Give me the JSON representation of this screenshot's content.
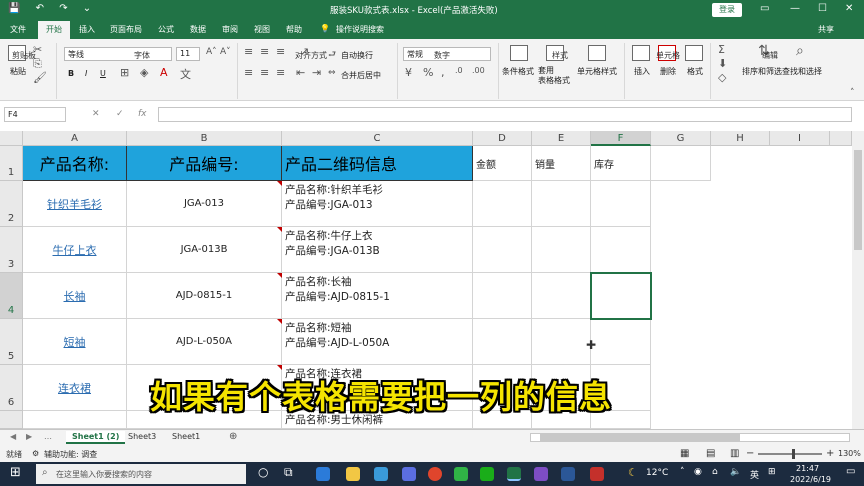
{
  "title_bar": {
    "title": "服装SKU款式表.xlsx  -  Excel(产品激活失败)",
    "login_label": "登录"
  },
  "ribbon_tabs": [
    "文件",
    "开始",
    "插入",
    "页面布局",
    "公式",
    "数据",
    "审阅",
    "视图",
    "帮助",
    "操作说明搜索"
  ],
  "share_label": "共享",
  "ribbon": {
    "paste_label": "粘贴",
    "clipboard_label": "剪贴板",
    "font_name": "等线",
    "font_size": "11",
    "font_label": "字体",
    "bold": "B",
    "italic": "I",
    "underline": "U",
    "wrap_label": "自动换行",
    "merge_label": "合并后居中",
    "align_label": "对齐方式",
    "number_format": "常规",
    "number_label": "数字",
    "cond_format_label": "条件格式",
    "table_format_label": "套用\n表格格式",
    "cell_style_label": "单元格样式",
    "styles_label": "样式",
    "insert_label": "插入",
    "delete_label": "删除",
    "format_label": "格式",
    "cells_label": "单元格",
    "sort_label": "排序和筛选",
    "find_label": "查找和选择",
    "edit_label": "编辑"
  },
  "formula_bar": {
    "name_box": "F4",
    "fx": "fx",
    "value": ""
  },
  "columns": [
    "A",
    "B",
    "C",
    "D",
    "E",
    "F",
    "G",
    "H",
    "I"
  ],
  "rows": [
    "1",
    "2",
    "3",
    "4",
    "5",
    "6"
  ],
  "header_row": {
    "a": "产品名称:",
    "b": "产品编号:",
    "c": "产品二维码信息",
    "d": "金额",
    "e": "销量",
    "f": "库存"
  },
  "products": [
    {
      "name": "针织羊毛衫",
      "code": "JGA-013",
      "qr": "产品名称:针织羊毛衫\n产品编号:JGA-013"
    },
    {
      "name": "牛仔上衣",
      "code": "JGA-013B",
      "qr": "产品名称:牛仔上衣\n产品编号:JGA-013B"
    },
    {
      "name": "长袖",
      "code": "AJD-0815-1",
      "qr": "产品名称:长袖\n产品编号:AJD-0815-1"
    },
    {
      "name": "短袖",
      "code": "AJD-L-050A",
      "qr": "产品名称:短袖\n产品编号:AJD-L-050A"
    },
    {
      "name": "连衣裙",
      "code": "",
      "qr": "产品名称:连衣裙"
    }
  ],
  "partial_row_text": "产品名称:男士休闲裤",
  "sheets": [
    "Sheet1 (2)",
    "Sheet3",
    "Sheet1"
  ],
  "status": {
    "ready": "就绪",
    "accessibility": "辅助功能: 调查",
    "zoom": "130%"
  },
  "caption": "如果有个表格需要把一列的信息",
  "taskbar": {
    "search_placeholder": "在这里输入你要搜索的内容",
    "weather": "12°C",
    "ime": "英",
    "time": "21:47",
    "date": "2022/6/19"
  }
}
